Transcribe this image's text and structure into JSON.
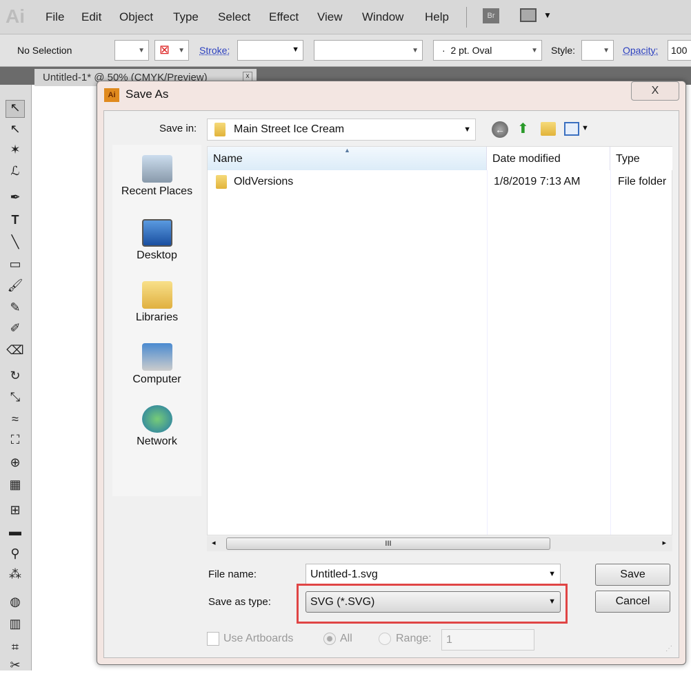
{
  "app": {
    "logo": "Ai",
    "menus": [
      "File",
      "Edit",
      "Object",
      "Type",
      "Select",
      "Effect",
      "View",
      "Window",
      "Help"
    ],
    "bridge": "Br"
  },
  "control": {
    "selection": "No Selection",
    "stroke_label": "Stroke:",
    "brush": "2 pt. Oval",
    "style_label": "Style:",
    "opacity_label": "Opacity:",
    "opacity_value": "100"
  },
  "doc_tab": {
    "title": "Untitled-1* @ 50% (CMYK/Preview)",
    "close": "x"
  },
  "dialog": {
    "title": "Save As",
    "close": "X",
    "save_in_label": "Save in:",
    "save_in_value": "Main Street Ice Cream",
    "places": [
      "Recent Places",
      "Desktop",
      "Libraries",
      "Computer",
      "Network"
    ],
    "columns": [
      "Name",
      "Date modified",
      "Type"
    ],
    "files": [
      {
        "name": "OldVersions",
        "date": "1/8/2019 7:13 AM",
        "type": "File folder"
      }
    ],
    "scroll_grip": "III",
    "file_name_label": "File name:",
    "file_name_value": "Untitled-1.svg",
    "type_label": "Save as type:",
    "type_value": "SVG (*.SVG)",
    "save": "Save",
    "cancel": "Cancel",
    "use_artboards": "Use Artboards",
    "all": "All",
    "range": "Range:",
    "range_value": "1"
  },
  "colors": {
    "highlight": "#e04545"
  }
}
